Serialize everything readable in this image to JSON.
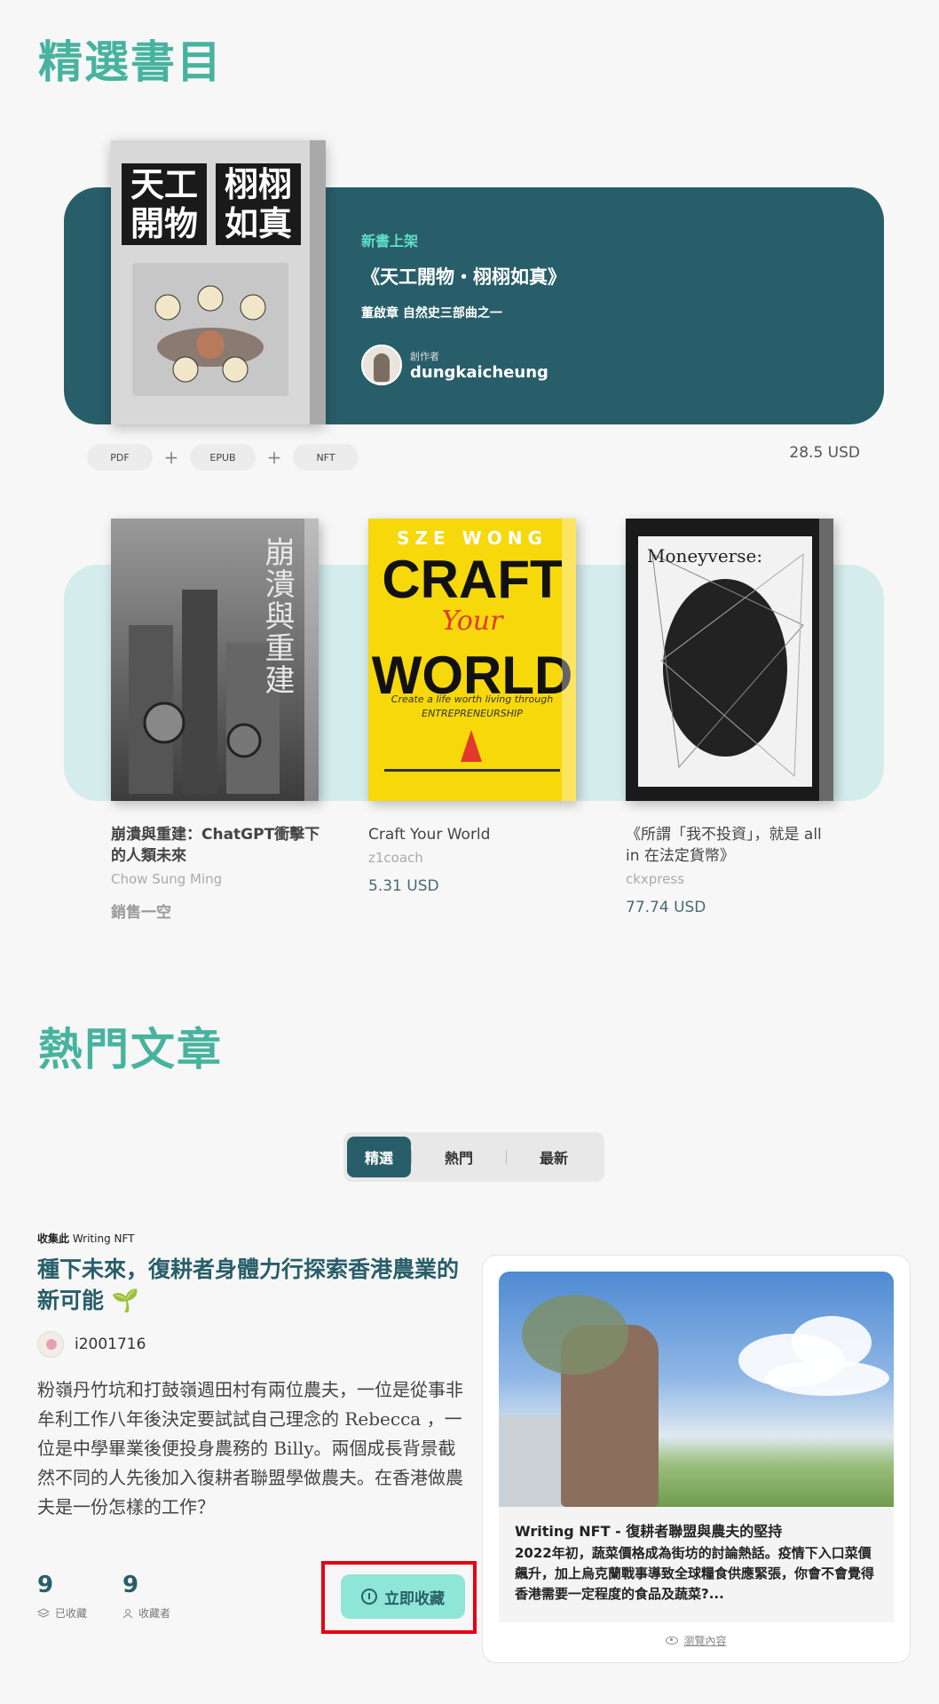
{
  "sections": {
    "featured_title": "精選書目",
    "articles_title": "熱門文章"
  },
  "hero": {
    "badge": "新書上架",
    "title": "《天工開物・栩栩如真》",
    "subtitle": "董啟章 自然史三部曲之一",
    "author_role": "創作者",
    "author_name": "dungkaicheung",
    "cover_text_left": "天工開物",
    "cover_text_right": "栩栩如真",
    "formats": [
      "PDF",
      "EPUB",
      "NFT"
    ],
    "price": "28.5 USD"
  },
  "books": [
    {
      "title": "崩潰與重建：ChatGPT衝擊下的人類未來",
      "author": "Chow Sung Ming",
      "status": "銷售一空",
      "cover_text": "崩潰與重建"
    },
    {
      "title": "Craft Your World",
      "author": "z1coach",
      "price": "5.31 USD",
      "cover_author": "SZE WONG",
      "cover_big": "CRAFT\nWORLD",
      "cover_your": "Your",
      "cover_tag": "Create a life worth living through ENTREPRENEURSHIP"
    },
    {
      "title": "《所謂「我不投資」，就是 all in 在法定貨幣》",
      "author": "ckxpress",
      "price": "77.74 USD",
      "cover_text": "Moneyverse:"
    }
  ],
  "tabs": [
    "精選",
    "熱門",
    "最新"
  ],
  "article": {
    "collect_prefix": "收集此",
    "collect_suffix": " Writing NFT",
    "title": "種下未來，復耕者身體力行探索香港農業的新可能 🌱",
    "author": "i2001716",
    "body": "粉嶺丹竹坑和打鼓嶺週田村有兩位農夫，一位是從事非牟利工作八年後決定要試試自己理念的 Rebecca ，一位是中學畢業後便投身農務的 Billy。兩個成長背景截然不同的人先後加入復耕者聯盟學做農夫。在香港做農夫是一份怎樣的工作？",
    "collected_count": "9",
    "collected_label": "已收藏",
    "collectors_count": "9",
    "collectors_label": "收藏者",
    "collect_button": "立即收藏"
  },
  "nft_card": {
    "title": "Writing NFT - 復耕者聯盟與農夫的堅持",
    "desc": "2022年初，蔬菜價格成為街坊的討論熱話。疫情下入口菜價飆升，加上烏克蘭戰事導致全球糧食供應緊張，你會不會覺得香港需要一定程度的食品及蔬菜?...",
    "link": "瀏覽內容"
  },
  "colors": {
    "accent": "#47b39f",
    "dark_teal": "#285e69",
    "mint": "#8ee6d7",
    "highlight": "#e60012"
  },
  "icons": [
    "info-circle-icon",
    "layers-icon",
    "user-icon",
    "eye-icon",
    "plus-icon"
  ]
}
